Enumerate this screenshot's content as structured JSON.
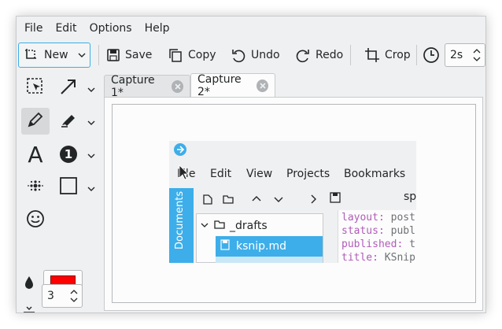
{
  "menu": {
    "items": [
      "File",
      "Edit",
      "Options",
      "Help"
    ]
  },
  "toolbar": {
    "new_label": "New",
    "save_label": "Save",
    "copy_label": "Copy",
    "undo_label": "Undo",
    "redo_label": "Redo",
    "crop_label": "Crop",
    "delay_value": "2s"
  },
  "sidebar": {
    "text_tool_glyph": "A",
    "number_tool_glyph": "1",
    "color_swatch": "#ff0000",
    "width_value": "3"
  },
  "tabs": [
    {
      "label": "Capture 1*"
    },
    {
      "label": "Capture 2*"
    }
  ],
  "capture": {
    "menu": [
      "File",
      "Edit",
      "View",
      "Projects",
      "Bookmarks"
    ],
    "side_tab": "Documents",
    "tree": [
      {
        "label": "_drafts"
      },
      {
        "label": "ksnip.md"
      }
    ],
    "toolbar_trailing_text": "sp",
    "code": [
      {
        "key": "layout:",
        "value": " post"
      },
      {
        "key": "status:",
        "value": " publ"
      },
      {
        "key": "published:",
        "value": " t"
      },
      {
        "key": "title:",
        "value": " KSnip"
      }
    ]
  },
  "colors": {
    "accent": "#3daee9",
    "window_bg": "#eff0f1",
    "surface": "#fcfcfc",
    "text": "#232627",
    "code_key": "#b05cb8",
    "code_value": "#6e7175"
  }
}
